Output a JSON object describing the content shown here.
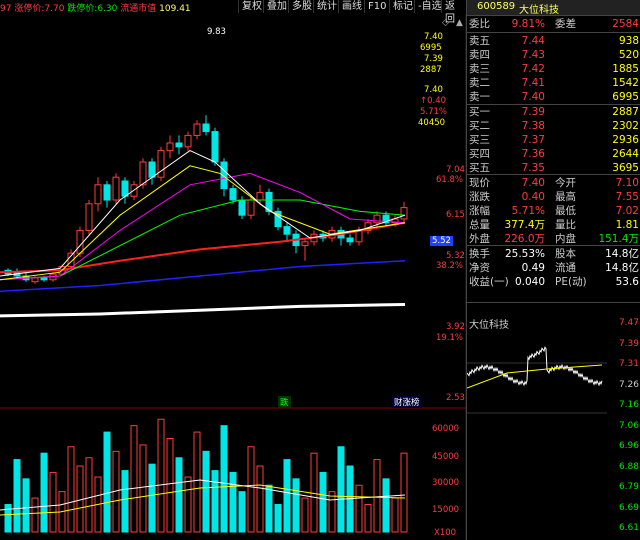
{
  "toolbar": {
    "info_prefix": "97",
    "limit_up_label": "涨停价:",
    "limit_up_value": "7.70",
    "limit_down_label": "跌停价:",
    "limit_down_value": "6.30",
    "mcap_label": "流通市值",
    "mcap_value": "109.41",
    "buttons": [
      "复权",
      "叠加",
      "多股",
      "统计",
      "画线",
      "F10",
      "标记",
      "-自选",
      "返回"
    ],
    "icons": [
      "diamond-icon",
      "up-icon"
    ]
  },
  "main_axis": {
    "left_labels": [
      "7.40",
      "6995",
      "7.39",
      "2887",
      "7.40",
      "↑0.40",
      "5.71%",
      "40450"
    ],
    "price_labels": [
      "7.04",
      "61.8%",
      "6.15",
      "5.52",
      "5.32",
      "38.2%",
      "3.92",
      "19.1%",
      "2.53"
    ],
    "peak_label": "9.83",
    "current_tag": "5.52",
    "bottom_tags": [
      "跌",
      "财涨榜"
    ]
  },
  "volume_axis": {
    "labels": [
      "60000",
      "45000",
      "30000",
      "15000",
      "X100"
    ]
  },
  "colors": {
    "up": "#ff3c3c",
    "down": "#00e6e6",
    "ma5": "#ffffff",
    "ma10": "#ffff00",
    "ma20": "#ff00ff",
    "ma30": "#00ff00",
    "ma60": "#ff2020",
    "ma120": "#0000ff",
    "ma250": "#ffffff"
  },
  "quote": {
    "code": "600589",
    "name": "大位科技",
    "webi": {
      "label": "委比",
      "value": "9.81%",
      "label2": "委差",
      "value2": "2584"
    },
    "sells": [
      {
        "label": "卖五",
        "price": "7.44",
        "vol": "938"
      },
      {
        "label": "卖四",
        "price": "7.43",
        "vol": "520"
      },
      {
        "label": "卖三",
        "price": "7.42",
        "vol": "1885"
      },
      {
        "label": "卖二",
        "price": "7.41",
        "vol": "1542"
      },
      {
        "label": "卖一",
        "price": "7.40",
        "vol": "6995"
      }
    ],
    "buys": [
      {
        "label": "买一",
        "price": "7.39",
        "vol": "2887"
      },
      {
        "label": "买二",
        "price": "7.38",
        "vol": "2302"
      },
      {
        "label": "买三",
        "price": "7.37",
        "vol": "2936"
      },
      {
        "label": "买四",
        "price": "7.36",
        "vol": "2644"
      },
      {
        "label": "买五",
        "price": "7.35",
        "vol": "3695"
      }
    ],
    "stats": [
      {
        "l1": "现价",
        "v1": "7.40",
        "l2": "今开",
        "v2": "7.10"
      },
      {
        "l1": "涨跌",
        "v1": "0.40",
        "l2": "最高",
        "v2": "7.55"
      },
      {
        "l1": "涨幅",
        "v1": "5.71%",
        "l2": "最低",
        "v2": "7.02"
      },
      {
        "l1": "总量",
        "v1": "377.4万",
        "l2": "量比",
        "v2": "1.81"
      },
      {
        "l1": "外盘",
        "v1": "226.0万",
        "l2": "内盘",
        "v2": "151.4万"
      }
    ],
    "stats2": [
      {
        "l1": "换手",
        "v1": "25.53%",
        "l2": "股本",
        "v2": "14.8亿"
      },
      {
        "l1": "净资",
        "v1": "0.49",
        "l2": "流通",
        "v2": "14.8亿"
      },
      {
        "l1": "收益(一)",
        "v1": "0.040",
        "l2": "PE(动)",
        "v2": "53.6"
      }
    ],
    "mini_title": "大位科技",
    "mini_labels": [
      "7.47",
      "7.39",
      "7.31",
      "7.26",
      "7.16",
      "7.06",
      "6.96",
      "6.88",
      "6.79",
      "6.69",
      "6.61"
    ]
  }
}
